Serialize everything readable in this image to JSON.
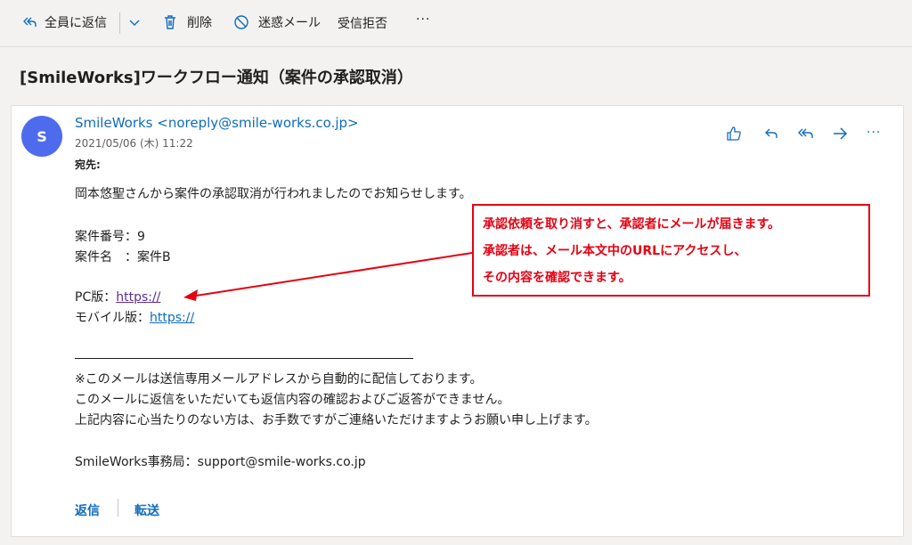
{
  "toolbar": {
    "reply_all_label": "全員に返信",
    "delete_label": "削除",
    "junk_label": "迷惑メール",
    "block_label": "受信拒否",
    "more_label": "···"
  },
  "message": {
    "subject": "[SmileWorks]ワークフロー通知（案件の承認取消）",
    "avatar_initial": "S",
    "sender": "SmileWorks <noreply@smile-works.co.jp>",
    "date": "2021/05/06 (木) 11:22",
    "to_label": "宛先:"
  },
  "body": {
    "line1": "岡本悠聖さんから案件の承認取消が行われましたのでお知らせします。",
    "case_no": "案件番号：9",
    "case_name": "案件名　：案件B",
    "pc_label": "PC版：",
    "pc_link": "https://",
    "mobile_label": "モバイル版：",
    "mobile_link": "https://",
    "note1": "※このメールは送信専用メールアドレスから自動的に配信しております。",
    "note2": "このメールに返信をいただいても返信内容の確認およびご返答ができません。",
    "note3": "上記内容に心当たりのない方は、お手数ですがご連絡いただけますようお願い申し上げます。",
    "signature": "SmileWorks事務局：support@smile-works.co.jp"
  },
  "callout": {
    "line1": "承認依頼を取り消すと、承認者にメールが届きます。",
    "line2": "承認者は、メール本文中のURLにアクセスし、",
    "line3": "その内容を確認できます。"
  },
  "footer": {
    "reply_label": "返信",
    "forward_label": "転送"
  },
  "colors": {
    "accent": "#0f6cbd",
    "avatar": "#4f6bed",
    "callout": "#e60012"
  },
  "icons": [
    "reply-all-icon",
    "chevron-down-icon",
    "trash-icon",
    "block-icon",
    "more-icon",
    "like-icon",
    "reply-icon",
    "forward-icon"
  ]
}
